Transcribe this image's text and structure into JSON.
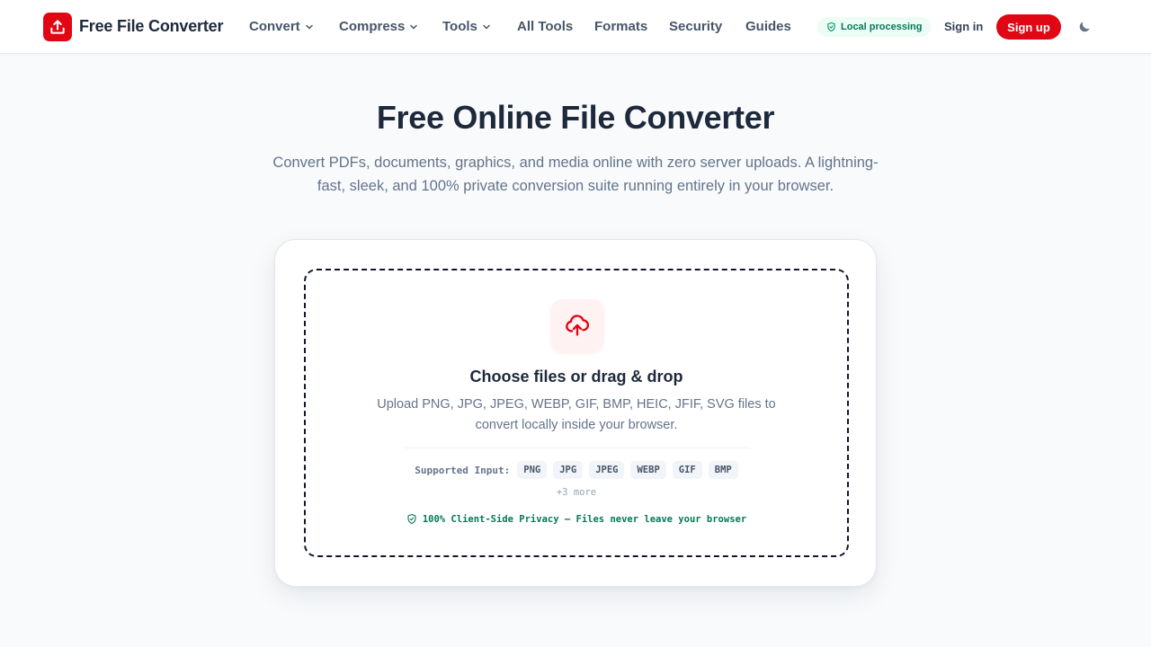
{
  "header": {
    "brand": "Free File Converter",
    "nav": [
      {
        "label": "Convert",
        "dropdown": true
      },
      {
        "label": "Compress",
        "dropdown": true
      },
      {
        "label": "Tools",
        "dropdown": true
      },
      {
        "label": "All Tools",
        "dropdown": false
      },
      {
        "label": "Formats",
        "dropdown": false
      },
      {
        "label": "Security",
        "dropdown": false
      },
      {
        "label": "Guides",
        "dropdown": false
      }
    ],
    "badge": "Local processing",
    "signin": "Sign in",
    "signup": "Sign up",
    "theme_icon": "moon-icon"
  },
  "hero": {
    "title": "Free Online File Converter",
    "subtitle": "Convert PDFs, documents, graphics, and media online with zero server uploads. A lightning-fast, sleek, and 100% private conversion suite running entirely in your browser."
  },
  "dropzone": {
    "icon": "cloud-upload-icon",
    "title": "Choose files or drag & drop",
    "description": "Upload PNG, JPG, JPEG, WEBP, GIF, BMP, HEIC, JFIF, SVG files to convert locally inside your browser.",
    "supported_label": "Supported Input:",
    "formats": [
      "PNG",
      "JPG",
      "JPEG",
      "WEBP",
      "GIF",
      "BMP"
    ],
    "more": "+3 more",
    "privacy": "100% Client-Side Privacy — Files never leave your browser"
  },
  "colors": {
    "brand_red": "#e10613",
    "privacy_green": "#047857",
    "text_dark": "#1e293b",
    "text_muted": "#64748b"
  }
}
